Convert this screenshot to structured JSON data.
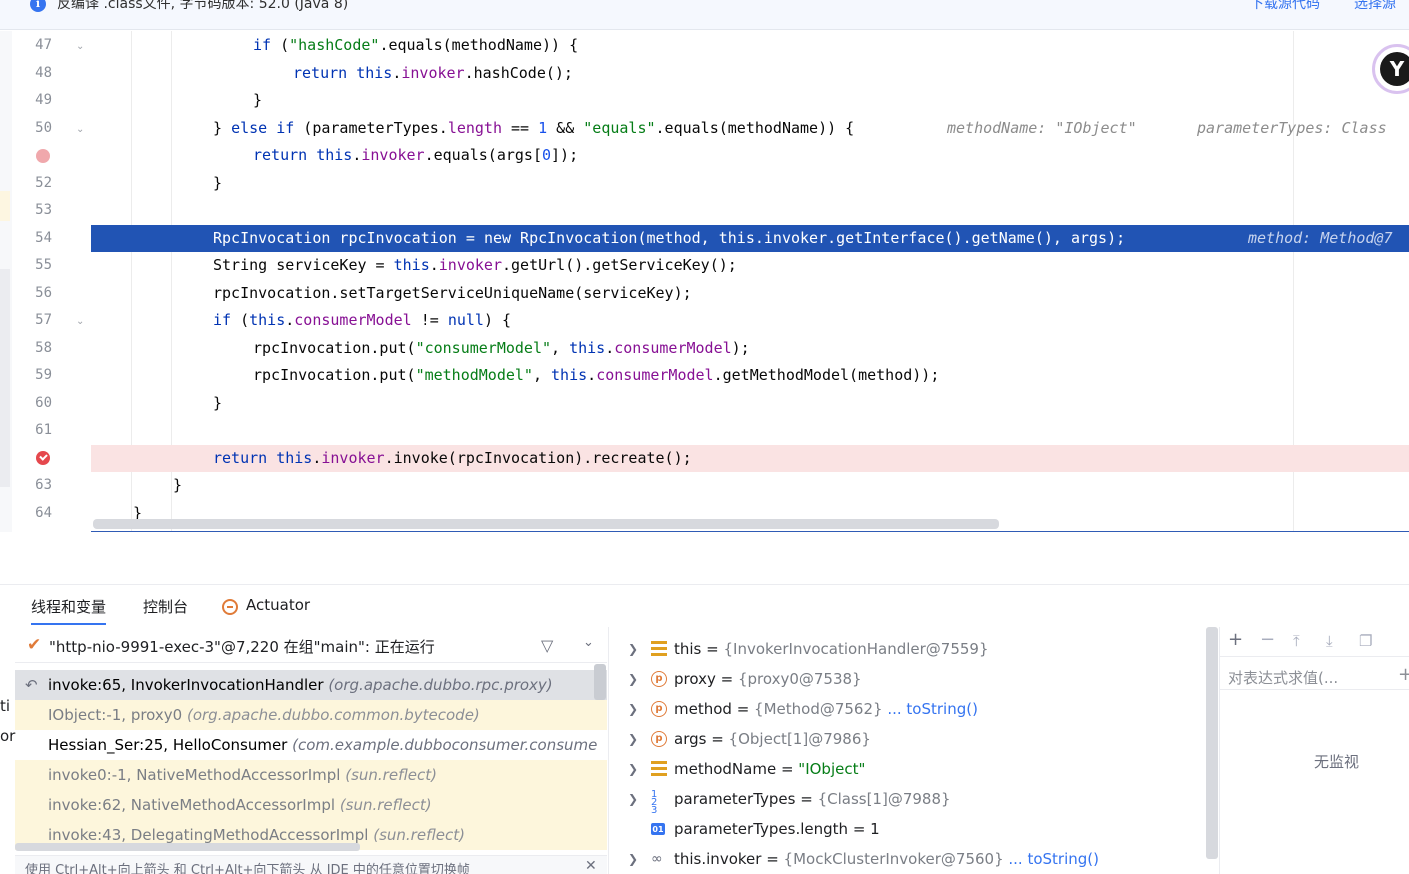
{
  "banner": {
    "message": "反编译 .class文件, 字节码版本: 52.0 (Java 8)",
    "download_label": "下载源代码",
    "choose_label": "选择源"
  },
  "editor": {
    "line_numbers": [
      "47",
      "48",
      "49",
      "50",
      "",
      "52",
      "53",
      "54",
      "55",
      "56",
      "57",
      "58",
      "59",
      "60",
      "61",
      "",
      "63",
      "64"
    ],
    "hints": {
      "line50_a": "methodName: \"IObject\"",
      "line50_b": "parameterTypes: Class",
      "line54": "method: Method@7"
    }
  },
  "tabs": {
    "threads_vars": "线程和变量",
    "console": "控制台",
    "actuator": "Actuator"
  },
  "thread": {
    "label": "\"http-nio-9991-exec-3\"@7,220 在组\"main\": 正在运行"
  },
  "frames": [
    {
      "name": "invoke:65, InvokerInvocationHandler",
      "pkg": "(org.apache.dubbo.rpc.proxy)"
    },
    {
      "name": "IObject:-1, proxy0",
      "pkg": "(org.apache.dubbo.common.bytecode)"
    },
    {
      "name": "Hessian_Ser:25, HelloConsumer",
      "pkg": "(com.example.dubboconsumer.consume"
    },
    {
      "name": "invoke0:-1, NativeMethodAccessorImpl",
      "pkg": "(sun.reflect)"
    },
    {
      "name": "invoke:62, NativeMethodAccessorImpl",
      "pkg": "(sun.reflect)"
    },
    {
      "name": "invoke:43, DelegatingMethodAccessorImpl",
      "pkg": "(sun.reflect)"
    }
  ],
  "frames_hint": "使用 Ctrl+Alt+向上箭头 和 Ctrl+Alt+向下箭头 从 IDE 中的任意位置切换帧",
  "left_clip": [
    "ti",
    "or"
  ],
  "variables": [
    {
      "name": "this",
      "eq": " = ",
      "val": "{InvokerInvocationHandler@7559}",
      "extra": ""
    },
    {
      "name": "proxy",
      "eq": " = ",
      "val": "{proxy0@7538}",
      "extra": ""
    },
    {
      "name": "method",
      "eq": " = ",
      "val": "{Method@7562}",
      "extra": " ... toString()"
    },
    {
      "name": "args",
      "eq": " = ",
      "val": "{Object[1]@7986}",
      "extra": ""
    },
    {
      "name": "methodName",
      "eq": " = ",
      "val": "\"IObject\"",
      "extra": ""
    },
    {
      "name": "parameterTypes",
      "eq": " = ",
      "val": "{Class[1]@7988}",
      "extra": ""
    },
    {
      "name": "parameterTypes.length",
      "eq": " = ",
      "val": "1",
      "extra": ""
    },
    {
      "name": "this.invoker",
      "eq": " = ",
      "val": "{MockClusterInvoker@7560}",
      "extra": " ... toString()"
    }
  ],
  "watch": {
    "placeholder": "对表达式求值(...",
    "empty": "无监视"
  },
  "colors": {
    "exec_line": "#2154b4",
    "breakpoint_line": "#fae3e3",
    "accent": "#3574f0"
  }
}
